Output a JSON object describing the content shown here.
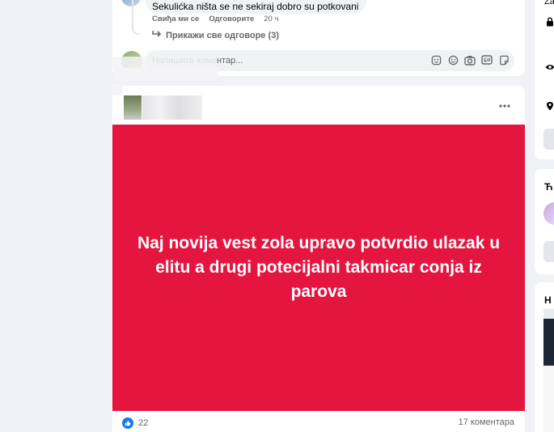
{
  "comment": {
    "text": "Sekulićka ništa se ne sekiraj dobro su potkovani",
    "like_label": "Свиђа ми се",
    "reply_label": "Одговорите",
    "time": "20 ч",
    "show_all_replies": "Прикажи све одговоре (3)"
  },
  "comment_composer": {
    "placeholder": "Напишите коментар..."
  },
  "post": {
    "more_icon": "ellipsis-icon",
    "text": "Naj novija vest zola upravo potvrdio ulazak u elitu a drugi potecijalni takmicar conja iz parova",
    "background_color": "#e4163f",
    "like_count": "22",
    "comment_count": "17 коментара"
  },
  "sidebar": {
    "top_text": "Za",
    "section_2_title": "Ћ",
    "section_3_title": "Н"
  },
  "colors": {
    "brand_blue": "#1877f2",
    "page_bg": "#f0f2f5"
  }
}
